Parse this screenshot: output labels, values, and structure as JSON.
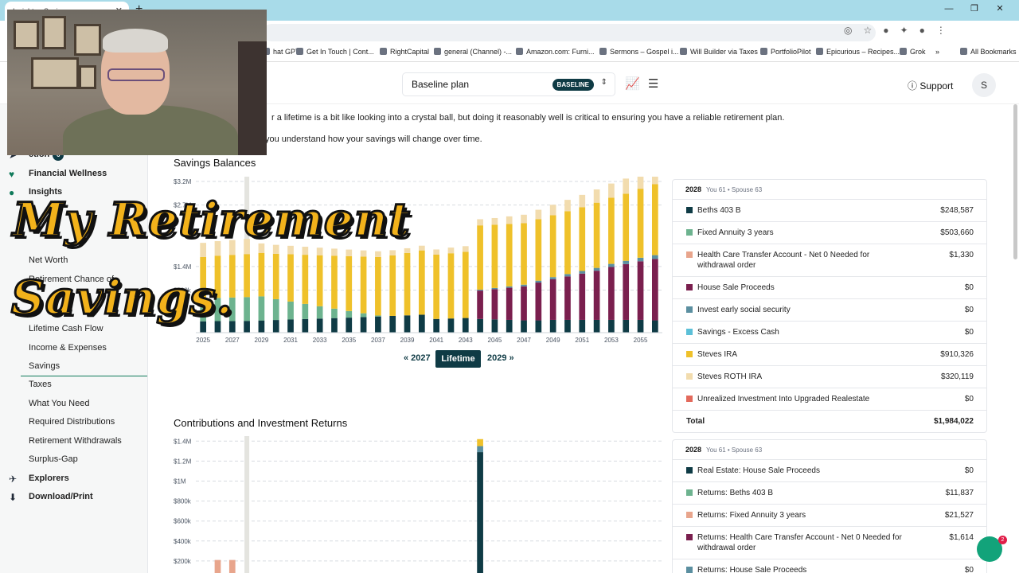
{
  "browser": {
    "tab_title": "Insights · Savings",
    "bookmarks": [
      "hat GPT",
      "Get In Touch | Cont...",
      "RightCapital",
      "general (Channel) -...",
      "Amazon.com: Furni...",
      "Sermons – Gospel i...",
      "Will Builder via Taxes",
      "PortfolioPilot",
      "Epicurious – Recipes...",
      "Grok",
      "»",
      "All Bookmarks"
    ]
  },
  "header": {
    "plan_name": "Baseline plan",
    "plan_badge": "BASELINE",
    "support_label": "Support",
    "avatar_initial": "S"
  },
  "sidebar": {
    "top_items": [
      {
        "label": "ction",
        "badge": "6",
        "icon": "action-icon"
      },
      {
        "label": "Financial Wellness",
        "icon": "heart-pulse-icon"
      },
      {
        "label": "Insights",
        "icon": "lightbulb-icon"
      }
    ],
    "sub_items": [
      "Net Worth",
      "Retirement Chance of",
      "Lifetime Cash Flow",
      "Income & Expenses",
      "Savings",
      "Taxes",
      "What You Need",
      "Required Distributions",
      "Retirement Withdrawals",
      "Surplus-Gap"
    ],
    "bottom_items": [
      {
        "label": "Explorers",
        "icon": "telescope-icon"
      },
      {
        "label": "Download/Print",
        "icon": "download-icon"
      }
    ]
  },
  "intro": {
    "line1": "r a lifetime is a bit like looking into a crystal ball, but doing it reasonably well is critical to ensuring you have a reliable retirement plan.",
    "line2": "you understand how your savings will change over time."
  },
  "overlay": {
    "line1": "My Retirement",
    "line2": "Savings."
  },
  "savings_section": {
    "title": "Savings Balances",
    "year_nav": {
      "prev": "« 2027",
      "current": "Lifetime",
      "next": "2029 »"
    },
    "legend": {
      "year": "2028",
      "ages": "You 61 • Spouse 63",
      "rows": [
        {
          "label": "Beths 403 B",
          "value": "$248,587",
          "color": "#0f3b45"
        },
        {
          "label": "Fixed Annuity 3 years",
          "value": "$503,660",
          "color": "#6db38f"
        },
        {
          "label": "Health Care Transfer Account - Net 0 Needed for withdrawal order",
          "value": "$1,330",
          "color": "#e8a58c"
        },
        {
          "label": "House Sale Proceeds",
          "value": "$0",
          "color": "#7a1f4e"
        },
        {
          "label": "Invest early social security",
          "value": "$0",
          "color": "#5b8fa0"
        },
        {
          "label": "Savings - Excess Cash",
          "value": "$0",
          "color": "#5cc0d8"
        },
        {
          "label": "Steves IRA",
          "value": "$910,326",
          "color": "#efc12a"
        },
        {
          "label": "Steves ROTH IRA",
          "value": "$320,119",
          "color": "#f2dcae"
        },
        {
          "label": "Unrealized Investment Into Upgraded Realestate",
          "value": "$0",
          "color": "#e36a5c"
        }
      ],
      "total_label": "Total",
      "total_value": "$1,984,022"
    }
  },
  "contrib_section": {
    "title": "Contributions and Investment Returns",
    "legend": {
      "year": "2028",
      "ages": "You 61 • Spouse 63",
      "rows": [
        {
          "label": "Real Estate: House Sale Proceeds",
          "value": "$0",
          "color": "#0f3b45"
        },
        {
          "label": "Returns: Beths 403 B",
          "value": "$11,837",
          "color": "#6db38f"
        },
        {
          "label": "Returns: Fixed Annuity 3 years",
          "value": "$21,527",
          "color": "#e8a58c"
        },
        {
          "label": "Returns: Health Care Transfer Account - Net 0 Needed for withdrawal order",
          "value": "$1,614",
          "color": "#7a1f4e"
        },
        {
          "label": "Returns: House Sale Proceeds",
          "value": "$0",
          "color": "#5b8fa0"
        }
      ]
    }
  },
  "chart_data": [
    {
      "type": "bar",
      "title": "Savings Balances",
      "ylim": [
        0,
        3300000
      ],
      "y_ticks": [
        {
          "v": 3200000,
          "label": "$3.2M"
        },
        {
          "v": 2700000,
          "label": "$2.7M"
        },
        {
          "v": 1400000,
          "label": "$1.4M"
        },
        {
          "v": 900000,
          "label": "$900k"
        }
      ],
      "x_tick_labels": [
        "2025",
        "2027",
        "2029",
        "2031",
        "2033",
        "2035",
        "2037",
        "2039",
        "2041",
        "2043",
        "2045",
        "2047",
        "2049",
        "2051",
        "2053",
        "2055"
      ],
      "x": [
        2025,
        2026,
        2027,
        2028,
        2029,
        2030,
        2031,
        2032,
        2033,
        2034,
        2035,
        2036,
        2037,
        2038,
        2039,
        2040,
        2041,
        2042,
        2043,
        2044,
        2045,
        2046,
        2047,
        2048,
        2049,
        2050,
        2051,
        2052,
        2053,
        2054,
        2055,
        2056
      ],
      "highlight_year": 2028,
      "series": [
        {
          "name": "Beths 403 B",
          "color": "#0f3b45",
          "values": [
            240000,
            244000,
            246000,
            248587,
            258000,
            268000,
            278000,
            288000,
            298000,
            308000,
            318000,
            330000,
            342000,
            354000,
            366000,
            380000,
            290000,
            300000,
            310000,
            290000,
            280000,
            270000,
            260000,
            260000,
            270000,
            270000,
            270000,
            270000,
            270000,
            270000,
            270000,
            260000
          ]
        },
        {
          "name": "Fixed Annuity 3 years",
          "color": "#6db38f",
          "values": [
            480000,
            490000,
            497000,
            503660,
            510000,
            440000,
            380000,
            320000,
            260000,
            200000,
            140000,
            80000,
            20000,
            0,
            0,
            0,
            0,
            0,
            0,
            0,
            0,
            0,
            0,
            0,
            0,
            0,
            0,
            0,
            0,
            0,
            0,
            0
          ]
        },
        {
          "name": "House Sale Proceeds",
          "color": "#7a1f4e",
          "values": [
            0,
            0,
            0,
            0,
            0,
            0,
            0,
            0,
            0,
            0,
            0,
            0,
            0,
            0,
            0,
            0,
            0,
            0,
            0,
            600000,
            640000,
            680000,
            720000,
            800000,
            860000,
            920000,
            980000,
            1040000,
            1120000,
            1180000,
            1240000,
            1300000
          ]
        },
        {
          "name": "Invest early social security",
          "color": "#5b8fa0",
          "values": [
            0,
            0,
            0,
            0,
            0,
            0,
            0,
            0,
            0,
            0,
            0,
            0,
            0,
            0,
            0,
            0,
            0,
            0,
            0,
            20000,
            25000,
            30000,
            35000,
            40000,
            45000,
            50000,
            55000,
            60000,
            65000,
            70000,
            75000,
            80000
          ]
        },
        {
          "name": "Steves IRA",
          "color": "#efc12a",
          "values": [
            880000,
            895000,
            903000,
            910326,
            920000,
            960000,
            1000000,
            1040000,
            1080000,
            1120000,
            1160000,
            1200000,
            1240000,
            1280000,
            1320000,
            1360000,
            1360000,
            1380000,
            1400000,
            1360000,
            1340000,
            1320000,
            1300000,
            1300000,
            1310000,
            1330000,
            1350000,
            1380000,
            1400000,
            1420000,
            1460000,
            1500000
          ]
        },
        {
          "name": "Steves ROTH IRA",
          "color": "#f2dcae",
          "values": [
            300000,
            308000,
            314000,
            320119,
            200000,
            190000,
            180000,
            170000,
            160000,
            150000,
            140000,
            130000,
            120000,
            110000,
            100000,
            100000,
            110000,
            120000,
            120000,
            130000,
            140000,
            160000,
            180000,
            200000,
            220000,
            240000,
            260000,
            280000,
            300000,
            320000,
            340000,
            360000
          ]
        }
      ]
    },
    {
      "type": "bar",
      "title": "Contributions and Investment Returns",
      "ylim": [
        0,
        1450000
      ],
      "y_ticks": [
        {
          "v": 1400000,
          "label": "$1.4M"
        },
        {
          "v": 1200000,
          "label": "$1.2M"
        },
        {
          "v": 1000000,
          "label": "$1M"
        },
        {
          "v": 800000,
          "label": "$800k"
        },
        {
          "v": 600000,
          "label": "$600k"
        },
        {
          "v": 400000,
          "label": "$400k"
        },
        {
          "v": 200000,
          "label": "$200k"
        }
      ],
      "x": [
        2025,
        2026,
        2027,
        2028,
        2029,
        2030,
        2031,
        2032,
        2033,
        2034,
        2035,
        2036,
        2037,
        2038,
        2039,
        2040,
        2041,
        2042,
        2043,
        2044,
        2045,
        2046,
        2047,
        2048,
        2049,
        2050,
        2051,
        2052,
        2053,
        2054,
        2055,
        2056
      ],
      "highlight_year": 2028,
      "series": [
        {
          "name": "Real Estate: House Sale Proceeds",
          "color": "#0f3b45",
          "values": [
            0,
            0,
            0,
            0,
            0,
            0,
            0,
            0,
            0,
            0,
            0,
            0,
            0,
            0,
            0,
            0,
            0,
            0,
            0,
            1290000,
            0,
            0,
            0,
            0,
            0,
            0,
            0,
            0,
            0,
            0,
            0,
            0
          ]
        },
        {
          "name": "Returns: Fixed Annuity 3 years",
          "color": "#e8a58c",
          "values": [
            0,
            210000,
            210000,
            0,
            0,
            0,
            0,
            0,
            0,
            0,
            0,
            0,
            0,
            0,
            0,
            0,
            0,
            0,
            0,
            0,
            0,
            0,
            0,
            0,
            0,
            0,
            0,
            0,
            0,
            0,
            0,
            0
          ]
        },
        {
          "name": "Returns: House Sale Proceeds",
          "color": "#5b8fa0",
          "values": [
            0,
            0,
            0,
            0,
            0,
            0,
            0,
            0,
            0,
            0,
            0,
            0,
            0,
            0,
            0,
            0,
            0,
            0,
            0,
            60000,
            0,
            0,
            0,
            0,
            0,
            0,
            0,
            0,
            0,
            0,
            0,
            0
          ]
        },
        {
          "name": "Steves IRA",
          "color": "#efc12a",
          "values": [
            0,
            0,
            0,
            0,
            0,
            0,
            0,
            0,
            0,
            0,
            0,
            0,
            0,
            0,
            0,
            0,
            0,
            0,
            0,
            70000,
            0,
            0,
            0,
            0,
            0,
            0,
            0,
            0,
            0,
            0,
            0,
            0
          ]
        }
      ]
    }
  ]
}
